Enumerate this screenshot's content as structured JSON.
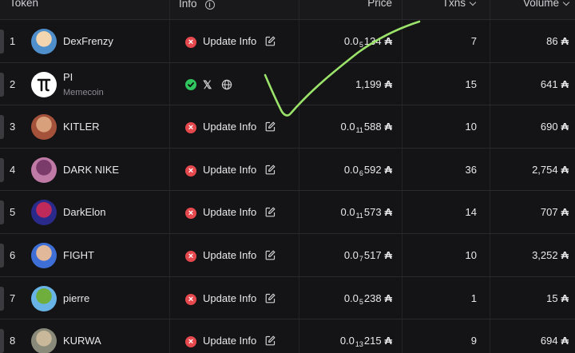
{
  "header": {
    "token": "Token",
    "info": "Info",
    "price": "Price",
    "txns": "Txns",
    "volume": "Volume"
  },
  "labels": {
    "update_info": "Update Info",
    "currency": "₳"
  },
  "rows": [
    {
      "rank": "1",
      "name": "DexFrenzy",
      "sub": "",
      "info": "update",
      "price_lead": "0.0",
      "price_zeros": "5",
      "price_digits": "134",
      "txns": "7",
      "volume": "86",
      "avatar": [
        "#4f8fcc",
        "#f3d6b0"
      ]
    },
    {
      "rank": "2",
      "name": "PI",
      "sub": "Memecoin",
      "info": "socials",
      "price_lead": "",
      "price_zeros": "",
      "price_digits": "1,199",
      "txns": "15",
      "volume": "641",
      "avatar": [
        "#ffffff",
        "#111111"
      ]
    },
    {
      "rank": "3",
      "name": "KITLER",
      "sub": "",
      "info": "update",
      "price_lead": "0.0",
      "price_zeros": "11",
      "price_digits": "588",
      "txns": "10",
      "volume": "690",
      "avatar": [
        "#a5523b",
        "#d9a07c"
      ]
    },
    {
      "rank": "4",
      "name": "DARK NIKE",
      "sub": "",
      "info": "update",
      "price_lead": "0.0",
      "price_zeros": "6",
      "price_digits": "592",
      "txns": "36",
      "volume": "2,754",
      "avatar": [
        "#c07aa6",
        "#7a3a6a"
      ]
    },
    {
      "rank": "5",
      "name": "DarkElon",
      "sub": "",
      "info": "update",
      "price_lead": "0.0",
      "price_zeros": "11",
      "price_digits": "573",
      "txns": "14",
      "volume": "707",
      "avatar": [
        "#2a2a8a",
        "#c02a5a"
      ]
    },
    {
      "rank": "6",
      "name": "FIGHT",
      "sub": "",
      "info": "update",
      "price_lead": "0.0",
      "price_zeros": "7",
      "price_digits": "517",
      "txns": "10",
      "volume": "3,252",
      "avatar": [
        "#3d6fd6",
        "#e2b89a"
      ]
    },
    {
      "rank": "7",
      "name": "pierre",
      "sub": "",
      "info": "update",
      "price_lead": "0.0",
      "price_zeros": "5",
      "price_digits": "238",
      "txns": "1",
      "volume": "15",
      "avatar": [
        "#69b4e6",
        "#6fae3c"
      ]
    },
    {
      "rank": "8",
      "name": "KURWA",
      "sub": "",
      "info": "update",
      "price_lead": "0.0",
      "price_zeros": "13",
      "price_digits": "215",
      "txns": "9",
      "volume": "694",
      "avatar": [
        "#8a8a7a",
        "#c9b89a"
      ]
    }
  ],
  "colors": {
    "error_badge": "#e5484d",
    "ok_badge": "#30c55e",
    "check_mark": "#9be36a"
  }
}
